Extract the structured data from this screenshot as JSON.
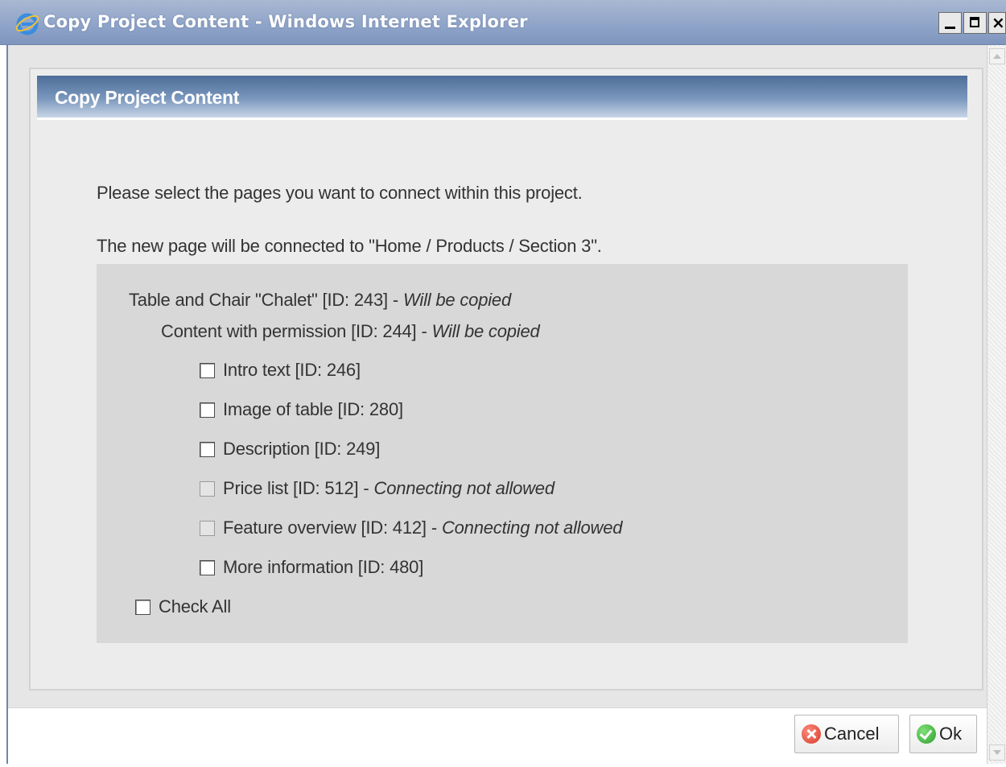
{
  "window": {
    "title": "Copy Project Content - Windows Internet Explorer",
    "icon": "internet-explorer-icon"
  },
  "dialog": {
    "title": "Copy Project Content",
    "message1": "Please select the pages you want to connect within this project.",
    "message2": "The new page will be connected to \"Home / Products / Section 3\".",
    "tree": {
      "parent": {
        "label": "Table and Chair \"Chalet\" [ID: 243]",
        "sep": "-",
        "note": "Will be copied"
      },
      "child": {
        "label": "Content with permission [ID: 244]",
        "sep": "-",
        "note": "Will be copied"
      },
      "items": [
        {
          "label": "Intro text [ID: 246]",
          "note": "",
          "checked": false,
          "enabled": true
        },
        {
          "label": "Image of table [ID: 280]",
          "note": "",
          "checked": false,
          "enabled": true
        },
        {
          "label": "Description [ID: 249]",
          "note": "",
          "checked": false,
          "enabled": true
        },
        {
          "label": "Price list [ID: 512]",
          "sep": "-",
          "note": "Connecting not allowed",
          "checked": false,
          "enabled": false
        },
        {
          "label": "Feature overview [ID: 412]",
          "sep": "-",
          "note": "Connecting not allowed",
          "checked": false,
          "enabled": false
        },
        {
          "label": "More information [ID: 480]",
          "note": "",
          "checked": false,
          "enabled": true
        }
      ],
      "check_all": {
        "label": "Check All",
        "checked": false
      }
    }
  },
  "footer": {
    "cancel_label": "Cancel",
    "ok_label": "Ok"
  },
  "colors": {
    "header_blue": "#4c6e98",
    "titlebar": "#8ea3c8",
    "panel_bg": "#ececec",
    "list_bg": "#d8d8d8"
  }
}
